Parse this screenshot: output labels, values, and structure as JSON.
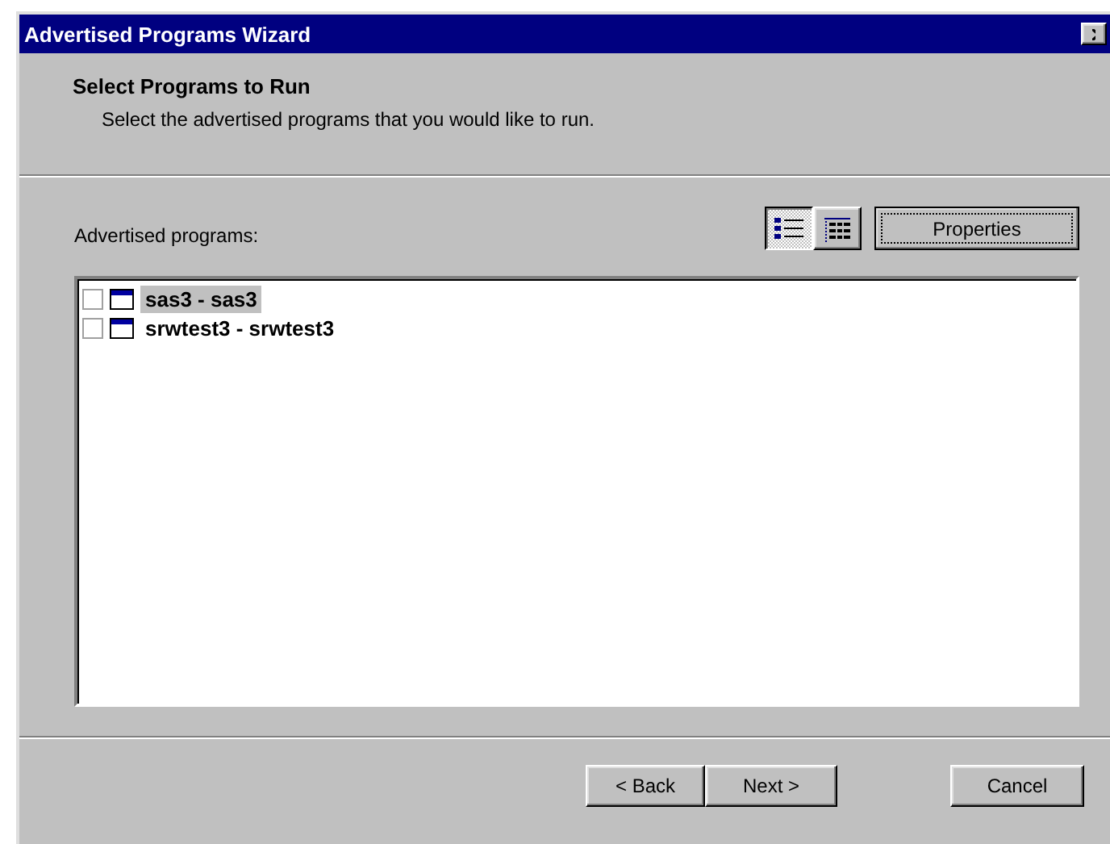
{
  "window": {
    "title": "Advertised Programs Wizard"
  },
  "header": {
    "title": "Select Programs to Run",
    "subtitle": "Select the advertised programs that you would like to run."
  },
  "list_label": "Advertised programs:",
  "view_buttons": [
    {
      "kind": "list",
      "selected": true
    },
    {
      "kind": "details",
      "selected": false
    }
  ],
  "properties_button": "Properties",
  "programs": [
    {
      "name": "sas3 - sas3",
      "checked": false,
      "selected": true
    },
    {
      "name": "srwtest3 - srwtest3",
      "checked": false,
      "selected": false
    }
  ],
  "buttons": [
    "< Back",
    "Next >",
    "Cancel"
  ]
}
